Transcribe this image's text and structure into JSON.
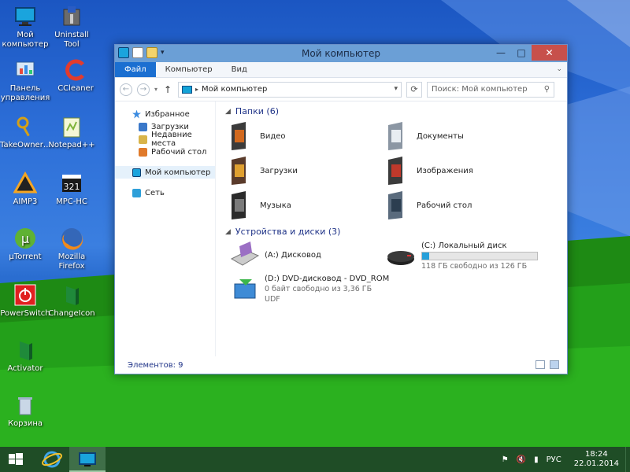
{
  "desktop": {
    "icons": [
      {
        "label": "Мой компьютер",
        "icon": "my-computer-icon"
      },
      {
        "label": "Uninstall Tool",
        "icon": "uninstall-tool-icon"
      },
      {
        "label": "Панель управления",
        "icon": "control-panel-icon"
      },
      {
        "label": "CCleaner",
        "icon": "ccleaner-icon"
      },
      {
        "label": "TakeOwner…",
        "icon": "takeowner-icon"
      },
      {
        "label": "Notepad++",
        "icon": "notepad-plus-plus-icon"
      },
      {
        "label": "AIMP3",
        "icon": "aimp3-icon"
      },
      {
        "label": "MPC-HC",
        "icon": "mpc-hc-icon"
      },
      {
        "label": "µTorrent",
        "icon": "utorrent-icon"
      },
      {
        "label": "Mozilla Firefox",
        "icon": "firefox-icon"
      },
      {
        "label": "PowerSwitch",
        "icon": "powerswitch-icon"
      },
      {
        "label": "ChangeIcon",
        "icon": "changeicon-icon"
      },
      {
        "label": "Activator",
        "icon": "activator-icon"
      },
      {
        "label": "Корзина",
        "icon": "recycle-bin-icon"
      }
    ]
  },
  "window": {
    "title": "Мой компьютер",
    "controls": {
      "minimize": "—",
      "maximize": "□",
      "close": "✕"
    },
    "ribbon_tabs": [
      "Файл",
      "Компьютер",
      "Вид"
    ],
    "address": {
      "path": "Мой компьютер",
      "separator": "▸"
    },
    "search_placeholder": "Поиск: Мой компьютер",
    "nav": {
      "favorites": "Избранное",
      "downloads": "Загрузки",
      "recent": "Недавние места",
      "desktop": "Рабочий стол",
      "computer": "Мой компьютер",
      "network": "Сеть"
    },
    "folders_header": "Папки (6)",
    "folders": [
      "Видео",
      "Документы",
      "Загрузки",
      "Изображения",
      "Музыка",
      "Рабочий стол"
    ],
    "devices_header": "Устройства и диски (3)",
    "drives": {
      "a": {
        "name": "(A:) Дисковод"
      },
      "c": {
        "name": "(C:) Локальный диск",
        "free": "118 ГБ свободно из 126 ГБ",
        "used_fraction": 0.064
      },
      "d": {
        "name": "(D:) DVD-дисковод - DVD_ROM",
        "free": "0 байт свободно из 3,36 ГБ",
        "fs": "UDF"
      }
    },
    "status": "Элементов: 9"
  },
  "taskbar": {
    "language": "РУС",
    "time": "18:24",
    "date": "22.01.2014"
  },
  "colors": {
    "accent": "#1b6fd1",
    "close": "#c7504b",
    "taskbar": "#1f4d26",
    "bar_fill": "#26a0da"
  }
}
